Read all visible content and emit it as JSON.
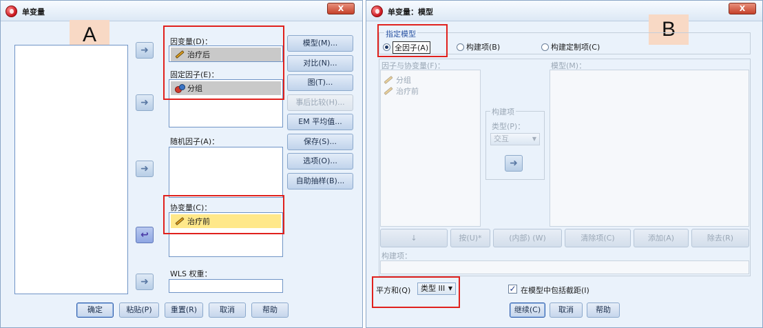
{
  "dialog_a": {
    "title": "单变量",
    "close_label": "X",
    "panel_letter": "A",
    "dependent_label": "因变量(D)：",
    "dependent_var": "治疗后",
    "fixed_label": "固定因子(E)：",
    "fixed_var": "分组",
    "random_label": "随机因子(A)：",
    "covariate_label": "协变量(C)：",
    "covariate_var": "治疗前",
    "wls_label": "WLS 权重：",
    "side_buttons": [
      "模型(M)...",
      "对比(N)...",
      "图(T)...",
      "事后比较(H)...",
      "EM 平均值...",
      "保存(S)...",
      "选项(O)...",
      "自助抽样(B)..."
    ],
    "bottom_buttons": [
      "确定",
      "粘贴(P)",
      "重置(R)",
      "取消",
      "帮助"
    ],
    "arrow_glyph": "➜"
  },
  "dialog_b": {
    "title": "单变量：模型",
    "close_label": "X",
    "panel_letter": "B",
    "spec_label": "指定模型",
    "radio_full": "全因子(A)",
    "radio_build": "构建项(B)",
    "radio_custom": "构建定制项(C)",
    "factors_label": "因子与协变量(F)：",
    "factor_items": [
      "分组",
      "治疗前"
    ],
    "model_label": "模型(M)：",
    "build_group_label": "构建项",
    "type_label": "类型(P)：",
    "type_value": "交互",
    "tool_buttons": [
      "↓",
      "按(U)*",
      "(内部) (W)",
      "清除项(C)",
      "添加(A)",
      "除去(R)"
    ],
    "build_terms_label": "构建项：",
    "ss_label": "平方和(Q)",
    "ss_value": "类型 III",
    "include_intercept_label": "在模型中包括截距(I)",
    "bottom_buttons": [
      "继续(C)",
      "取消",
      "帮助"
    ],
    "arrow_glyph": "➜"
  },
  "colors": {
    "highlight": "#e0201c",
    "dialog_bg": "#eaf2fb",
    "letter_bg": "#f8d9c5",
    "covariate_fill": "#ffe88a"
  }
}
